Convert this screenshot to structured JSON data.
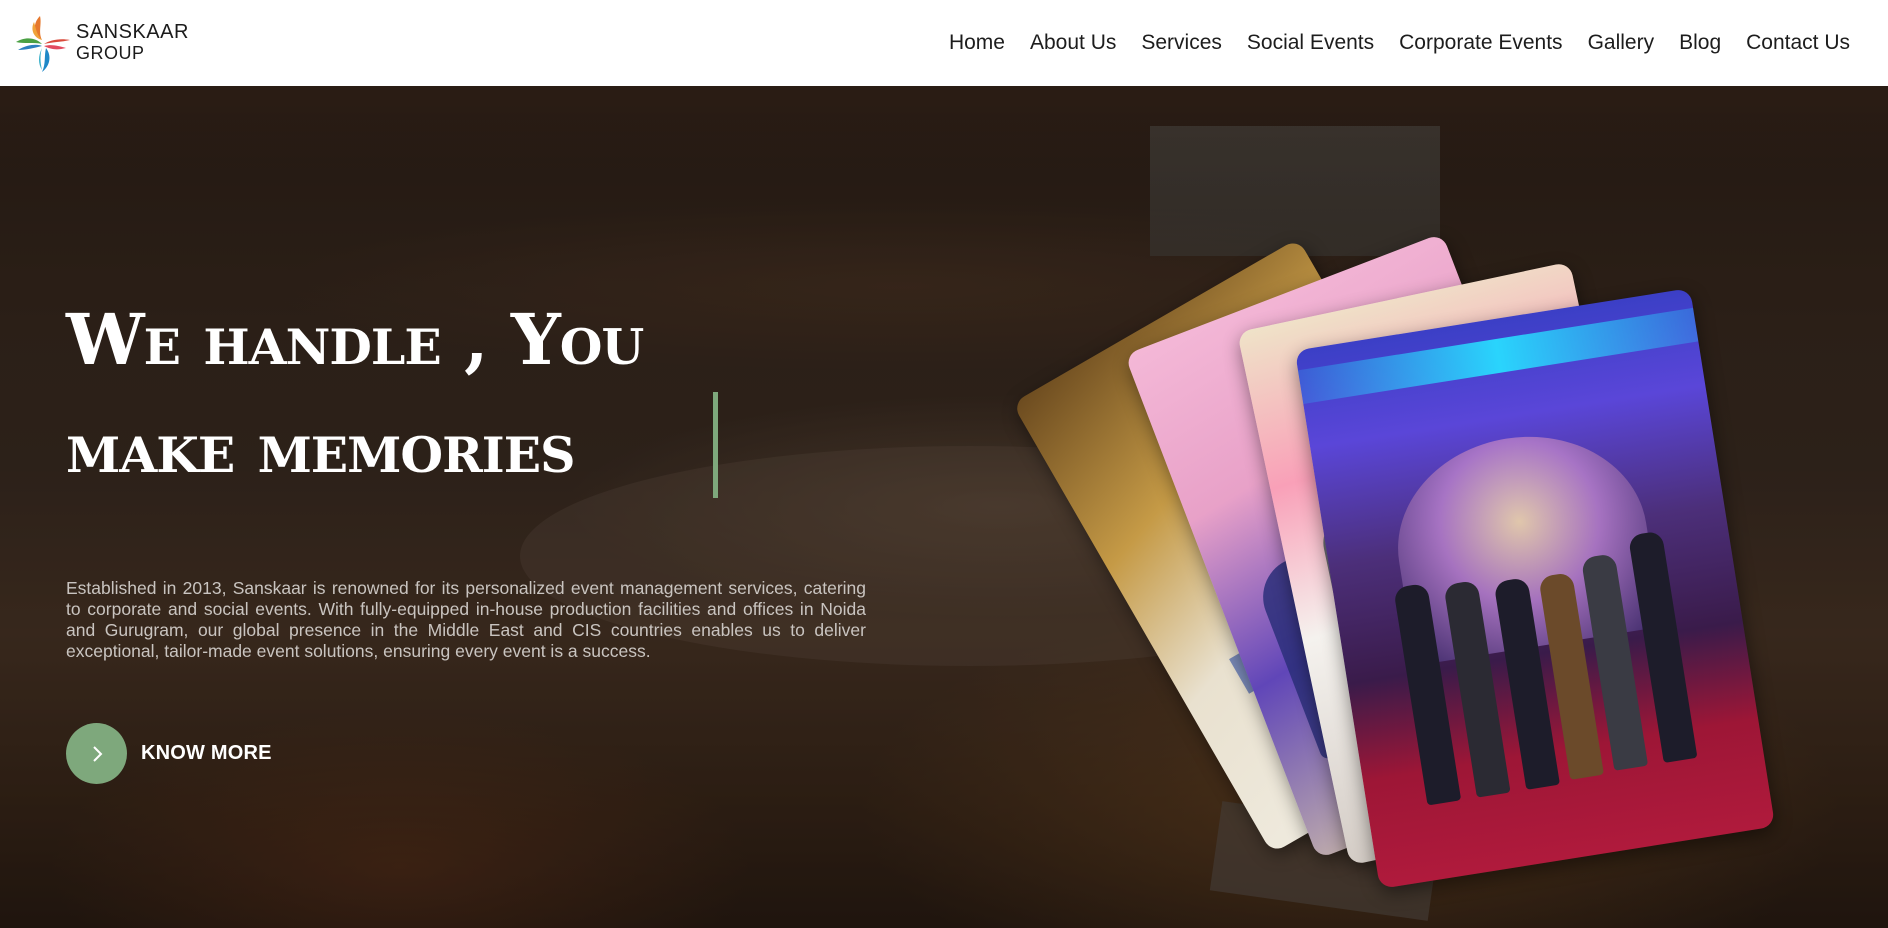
{
  "brand": {
    "name_line1": "SANSKAAR",
    "name_line2": "GROUP"
  },
  "nav": {
    "items": [
      {
        "label": "Home",
        "name": "nav-home"
      },
      {
        "label": "About Us",
        "name": "nav-about-us"
      },
      {
        "label": "Services",
        "name": "nav-services"
      },
      {
        "label": "Social Events",
        "name": "nav-social-events"
      },
      {
        "label": "Corporate Events",
        "name": "nav-corporate-events"
      },
      {
        "label": "Gallery",
        "name": "nav-gallery"
      },
      {
        "label": "Blog",
        "name": "nav-blog"
      },
      {
        "label": "Contact Us",
        "name": "nav-contact-us"
      }
    ]
  },
  "hero": {
    "headline_line1": "We handle , You",
    "headline_line2": "make memories",
    "description": "Established in 2013, Sanskaar is renowned for its personalized event management services, catering to corporate and social events. With fully-equipped in-house production facilities and offices in Noida and Gurugram, our global presence in the Middle East and CIS countries enables us to deliver exceptional, tailor-made event solutions, ensuring every event is a success.",
    "cta_label": "KNOW MORE",
    "cta_icon": "chevron-right-icon"
  },
  "colors": {
    "accent": "#7ea87c",
    "header_bg": "#ffffff",
    "text_light": "#c9c4c0"
  }
}
